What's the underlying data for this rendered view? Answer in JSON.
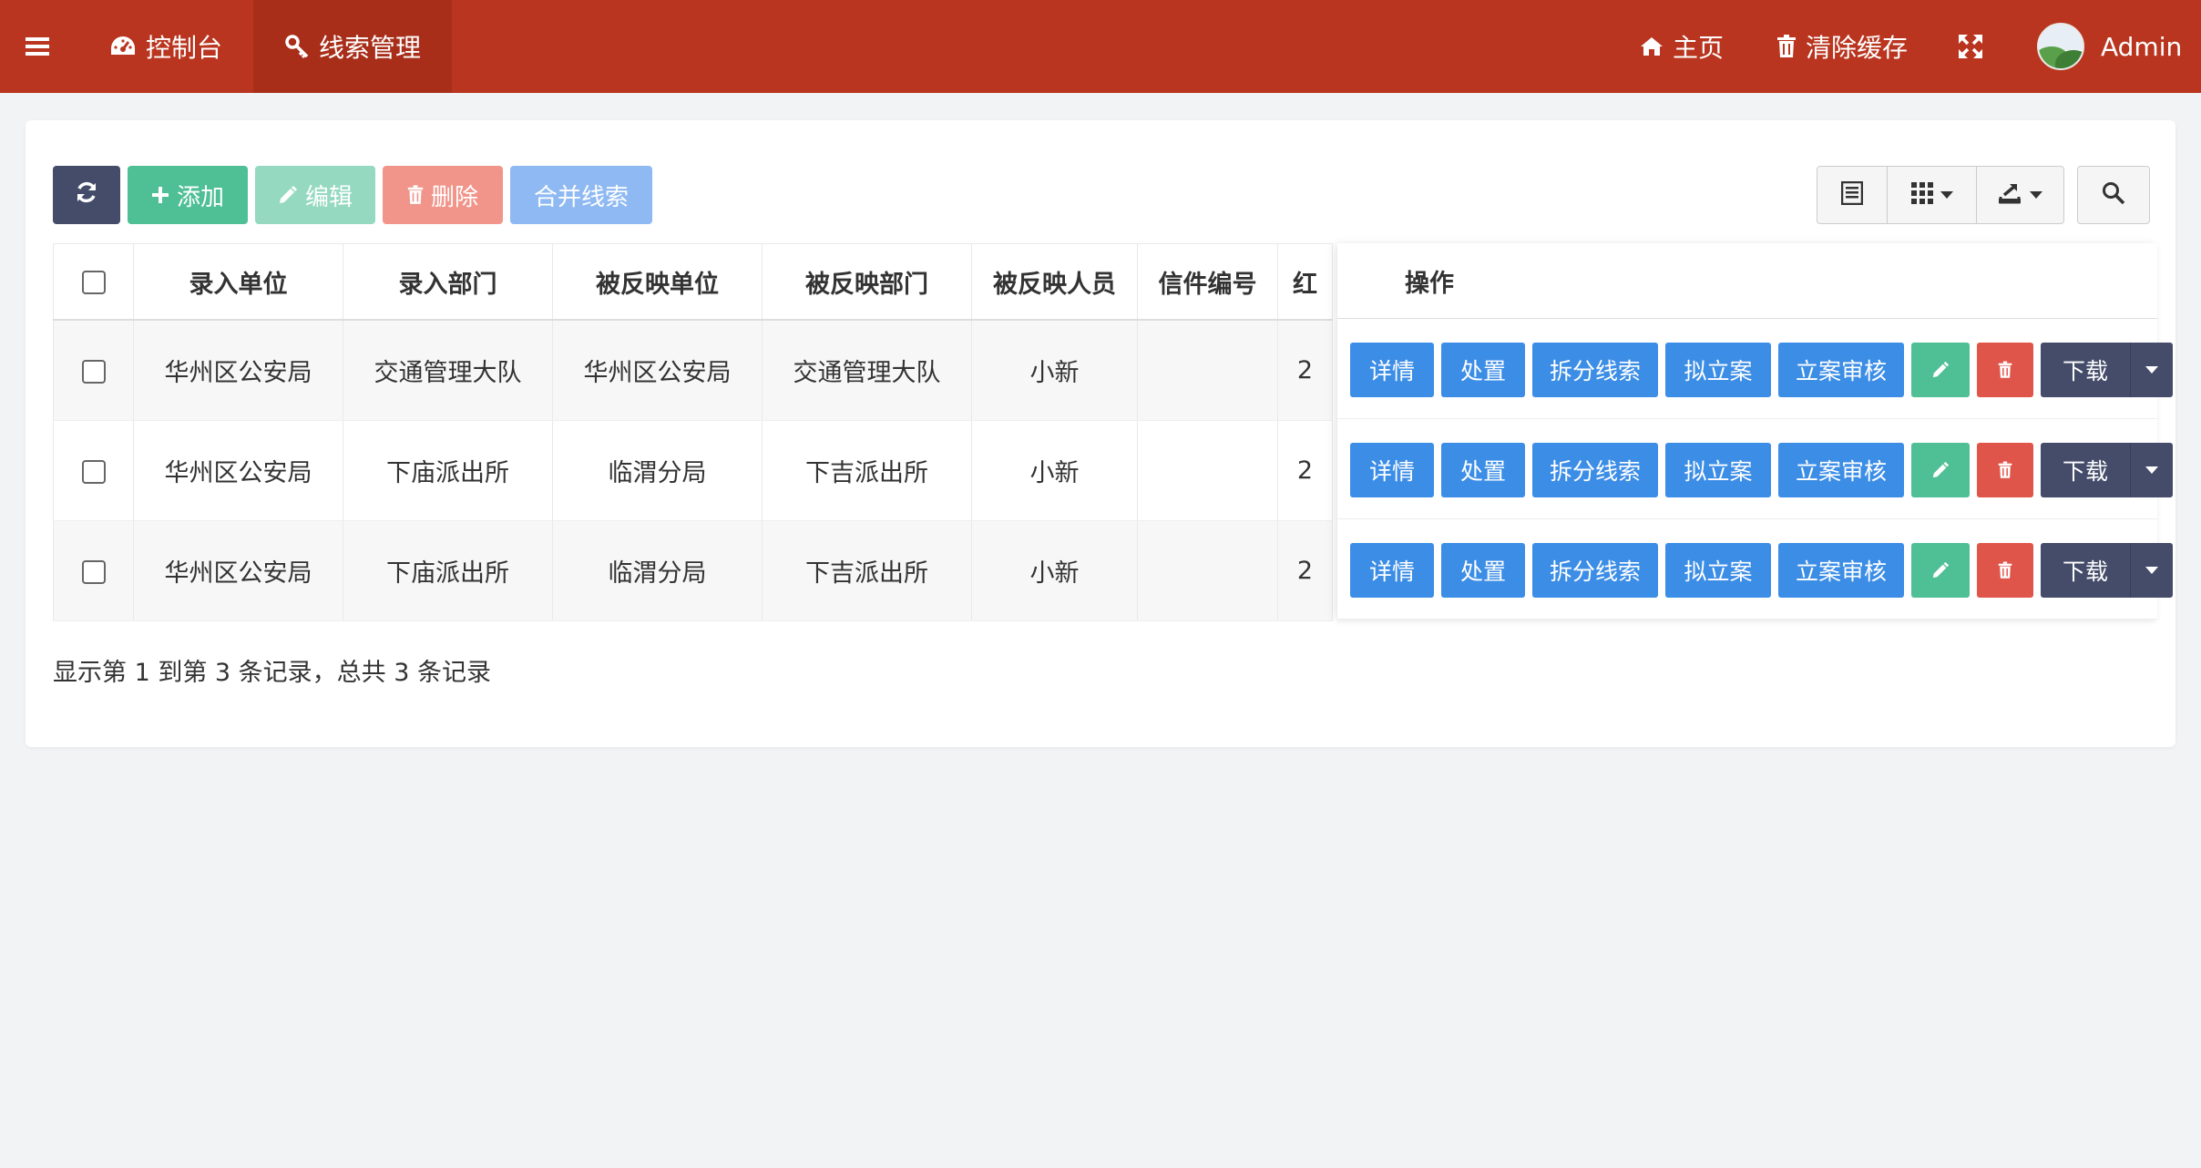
{
  "nav": {
    "dashboard_label": "控制台",
    "clues_label": "线索管理",
    "home_label": "主页",
    "clear_cache_label": "清除缓存",
    "user_name": "Admin"
  },
  "toolbar": {
    "add_label": "添加",
    "edit_label": "编辑",
    "delete_label": "删除",
    "merge_label": "合并线索"
  },
  "table": {
    "columns": [
      "录入单位",
      "录入部门",
      "被反映单位",
      "被反映部门",
      "被反映人员",
      "信件编号",
      "红"
    ],
    "ops_header": "操作",
    "rows": [
      {
        "entry_unit": "华州区公安局",
        "entry_dept": "交通管理大队",
        "reported_unit": "华州区公安局",
        "reported_dept": "交通管理大队",
        "reported_person": "小新",
        "letter_no": "",
        "partial": "2"
      },
      {
        "entry_unit": "华州区公安局",
        "entry_dept": "下庙派出所",
        "reported_unit": "临渭分局",
        "reported_dept": "下吉派出所",
        "reported_person": "小新",
        "letter_no": "",
        "partial": "2"
      },
      {
        "entry_unit": "华州区公安局",
        "entry_dept": "下庙派出所",
        "reported_unit": "临渭分局",
        "reported_dept": "下吉派出所",
        "reported_person": "小新",
        "letter_no": "",
        "partial": "2"
      }
    ],
    "row_actions": {
      "detail": "详情",
      "handle": "处置",
      "split": "拆分线索",
      "propose": "拟立案",
      "review": "立案审核",
      "download": "下载"
    }
  },
  "pager": {
    "info": "显示第 1 到第 3 条记录，总共 3 条记录"
  },
  "colors": {
    "navbar": "#b9351f",
    "primary": "#3c8de6",
    "success": "#4fbf96",
    "danger": "#e0554a",
    "dark": "#444c69"
  }
}
